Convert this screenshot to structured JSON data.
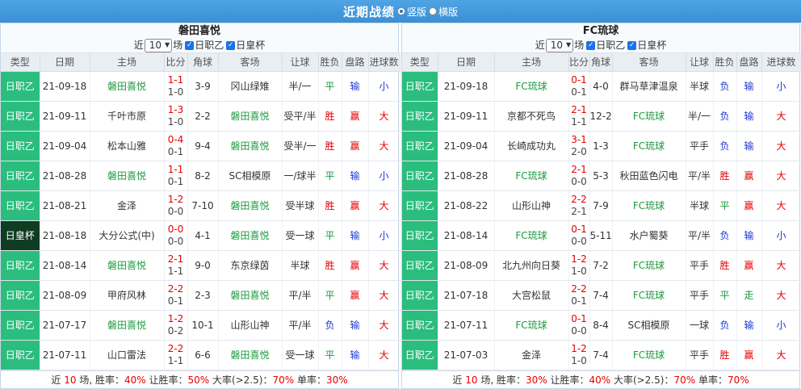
{
  "header": {
    "title": "近期战绩",
    "view_options": [
      {
        "label": "竖版",
        "selected": true
      },
      {
        "label": "横版",
        "selected": false
      }
    ]
  },
  "labels": {
    "near": "近",
    "games_unit": "场",
    "filter_a": "日职乙",
    "filter_b": "日皇杯",
    "cols": [
      "类型",
      "日期",
      "主场",
      "比分",
      "角球",
      "客场",
      "让球",
      "胜负",
      "盘路",
      "进球数"
    ]
  },
  "colors": {
    "header_blue": "#3a8fd6",
    "league_green": "#2bbd7e",
    "cup_dark": "#103c22",
    "win_red": "#e60000",
    "draw_green": "#1c9a3e",
    "lose_blue": "#1a38d6"
  },
  "left": {
    "team": "磐田喜悦",
    "count": "10",
    "rows": [
      {
        "type": "日职乙",
        "date": "21-09-18",
        "home": "磐田喜悦",
        "hl": "home",
        "score": "1-1",
        "half": "1-0",
        "corner": "3-9",
        "away": "冈山绿雉",
        "handicap": "半/一",
        "result": "平",
        "pan": "输",
        "ou": "小"
      },
      {
        "type": "日职乙",
        "date": "21-09-11",
        "home": "千叶市原",
        "hl": "away",
        "score": "1-3",
        "half": "1-0",
        "corner": "2-2",
        "away": "磐田喜悦",
        "handicap": "受平/半",
        "result": "胜",
        "pan": "赢",
        "ou": "大"
      },
      {
        "type": "日职乙",
        "date": "21-09-04",
        "home": "松本山雅",
        "hl": "away",
        "score": "0-4",
        "half": "0-1",
        "corner": "9-4",
        "away": "磐田喜悦",
        "handicap": "受半/一",
        "result": "胜",
        "pan": "赢",
        "ou": "大"
      },
      {
        "type": "日职乙",
        "date": "21-08-28",
        "home": "磐田喜悦",
        "hl": "home",
        "score": "1-1",
        "half": "0-1",
        "corner": "8-2",
        "away": "SC相模原",
        "handicap": "一/球半",
        "result": "平",
        "pan": "输",
        "ou": "小"
      },
      {
        "type": "日职乙",
        "date": "21-08-21",
        "home": "金泽",
        "hl": "away",
        "score": "1-2",
        "half": "0-0",
        "corner": "7-10",
        "away": "磐田喜悦",
        "handicap": "受半球",
        "result": "胜",
        "pan": "赢",
        "ou": "大"
      },
      {
        "type": "日皇杯",
        "date": "21-08-18",
        "home": "大分公式(中)",
        "hl": "away",
        "score": "0-0",
        "half": "0-0",
        "corner": "4-1",
        "away": "磐田喜悦",
        "handicap": "受一球",
        "result": "平",
        "pan": "输",
        "ou": "小"
      },
      {
        "type": "日职乙",
        "date": "21-08-14",
        "home": "磐田喜悦",
        "hl": "home",
        "score": "2-1",
        "half": "1-1",
        "corner": "9-0",
        "away": "东京绿茵",
        "handicap": "半球",
        "result": "胜",
        "pan": "赢",
        "ou": "大"
      },
      {
        "type": "日职乙",
        "date": "21-08-09",
        "home": "甲府风林",
        "hl": "away",
        "score": "2-2",
        "half": "0-1",
        "corner": "2-3",
        "away": "磐田喜悦",
        "handicap": "平/半",
        "result": "平",
        "pan": "赢",
        "ou": "大"
      },
      {
        "type": "日职乙",
        "date": "21-07-17",
        "home": "磐田喜悦",
        "hl": "home",
        "score": "1-2",
        "half": "0-2",
        "corner": "10-1",
        "away": "山形山神",
        "handicap": "平/半",
        "result": "负",
        "pan": "输",
        "ou": "大"
      },
      {
        "type": "日职乙",
        "date": "21-07-11",
        "home": "山口雷法",
        "hl": "away",
        "score": "2-2",
        "half": "1-1",
        "corner": "6-6",
        "away": "磐田喜悦",
        "handicap": "受一球",
        "result": "平",
        "pan": "输",
        "ou": "大"
      }
    ],
    "summary": {
      "prefix": "近",
      "count": "10",
      "t1": " 场, 胜率：",
      "win": "40%",
      "t2": " 让胜率：",
      "hwin": "50%",
      "t3": " 大率(>2.5)：",
      "big": "70%",
      "t4": " 单率：",
      "odd": "30%"
    }
  },
  "right": {
    "team": "FC琉球",
    "count": "10",
    "rows": [
      {
        "type": "日职乙",
        "date": "21-09-18",
        "home": "FC琉球",
        "hl": "home",
        "score": "0-1",
        "half": "0-1",
        "corner": "4-0",
        "away": "群马草津温泉",
        "handicap": "半球",
        "result": "负",
        "pan": "输",
        "ou": "小"
      },
      {
        "type": "日职乙",
        "date": "21-09-11",
        "home": "京都不死鸟",
        "hl": "away",
        "score": "2-1",
        "half": "1-1",
        "corner": "12-2",
        "away": "FC琉球",
        "handicap": "半/一",
        "result": "负",
        "pan": "输",
        "ou": "大"
      },
      {
        "type": "日职乙",
        "date": "21-09-04",
        "home": "长崎成功丸",
        "hl": "away",
        "score": "3-1",
        "half": "2-0",
        "corner": "1-3",
        "away": "FC琉球",
        "handicap": "平手",
        "result": "负",
        "pan": "输",
        "ou": "大"
      },
      {
        "type": "日职乙",
        "date": "21-08-28",
        "home": "FC琉球",
        "hl": "home",
        "score": "2-1",
        "half": "0-0",
        "corner": "5-3",
        "away": "秋田蓝色闪电",
        "handicap": "平/半",
        "result": "胜",
        "pan": "赢",
        "ou": "大"
      },
      {
        "type": "日职乙",
        "date": "21-08-22",
        "home": "山形山神",
        "hl": "away",
        "score": "2-2",
        "half": "2-1",
        "corner": "7-9",
        "away": "FC琉球",
        "handicap": "半球",
        "result": "平",
        "pan": "赢",
        "ou": "大"
      },
      {
        "type": "日职乙",
        "date": "21-08-14",
        "home": "FC琉球",
        "hl": "home",
        "score": "0-1",
        "half": "0-0",
        "corner": "5-11",
        "away": "水户蜀葵",
        "handicap": "平/半",
        "result": "负",
        "pan": "输",
        "ou": "小"
      },
      {
        "type": "日职乙",
        "date": "21-08-09",
        "home": "北九州向日葵",
        "hl": "away",
        "score": "1-2",
        "half": "1-0",
        "corner": "7-2",
        "away": "FC琉球",
        "handicap": "平手",
        "result": "胜",
        "pan": "赢",
        "ou": "大"
      },
      {
        "type": "日职乙",
        "date": "21-07-18",
        "home": "大宫松鼠",
        "hl": "away",
        "score": "2-2",
        "half": "0-1",
        "corner": "7-4",
        "away": "FC琉球",
        "handicap": "平手",
        "result": "平",
        "pan": "走",
        "ou": "大"
      },
      {
        "type": "日职乙",
        "date": "21-07-11",
        "home": "FC琉球",
        "hl": "home",
        "score": "0-1",
        "half": "0-0",
        "corner": "8-4",
        "away": "SC相模原",
        "handicap": "一球",
        "result": "负",
        "pan": "输",
        "ou": "小"
      },
      {
        "type": "日职乙",
        "date": "21-07-03",
        "home": "金泽",
        "hl": "away",
        "score": "1-2",
        "half": "1-0",
        "corner": "7-4",
        "away": "FC琉球",
        "handicap": "平手",
        "result": "胜",
        "pan": "赢",
        "ou": "大"
      }
    ],
    "summary": {
      "prefix": "近",
      "count": "10",
      "t1": " 场, 胜率：",
      "win": "30%",
      "t2": " 让胜率：",
      "hwin": "40%",
      "t3": " 大率(>2.5)：",
      "big": "70%",
      "t4": " 单率：",
      "odd": "70%"
    }
  }
}
